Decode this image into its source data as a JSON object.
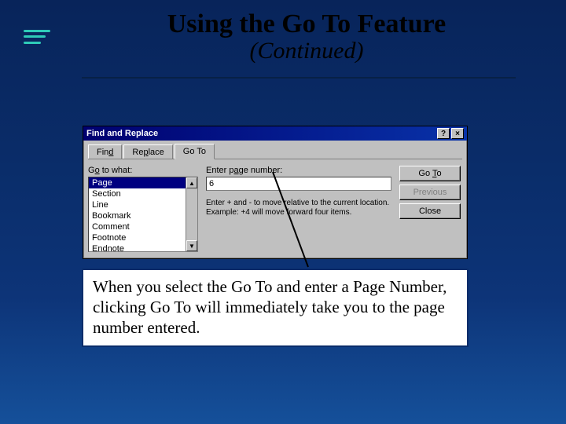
{
  "slide": {
    "title": "Using the Go To Feature",
    "subtitle": "(Continued)"
  },
  "dialog": {
    "title": "Find and Replace",
    "tabs": {
      "find": "Find",
      "replace": "Replace",
      "goto": "Go To"
    },
    "goto_panel": {
      "list_label": "Go to what:",
      "items": [
        "Page",
        "Section",
        "Line",
        "Bookmark",
        "Comment",
        "Footnote",
        "Endnote"
      ],
      "input_label": "Enter page number:",
      "input_value": "6",
      "hint": "Enter + and - to move relative to the current location. Example: +4 will move forward four items."
    },
    "buttons": {
      "goto": "Go To",
      "previous": "Previous",
      "close": "Close"
    },
    "titlebar_help": "?",
    "titlebar_close": "×"
  },
  "caption": "When you select the Go To and enter a Page Number, clicking Go To will immediately take you to the page number entered."
}
